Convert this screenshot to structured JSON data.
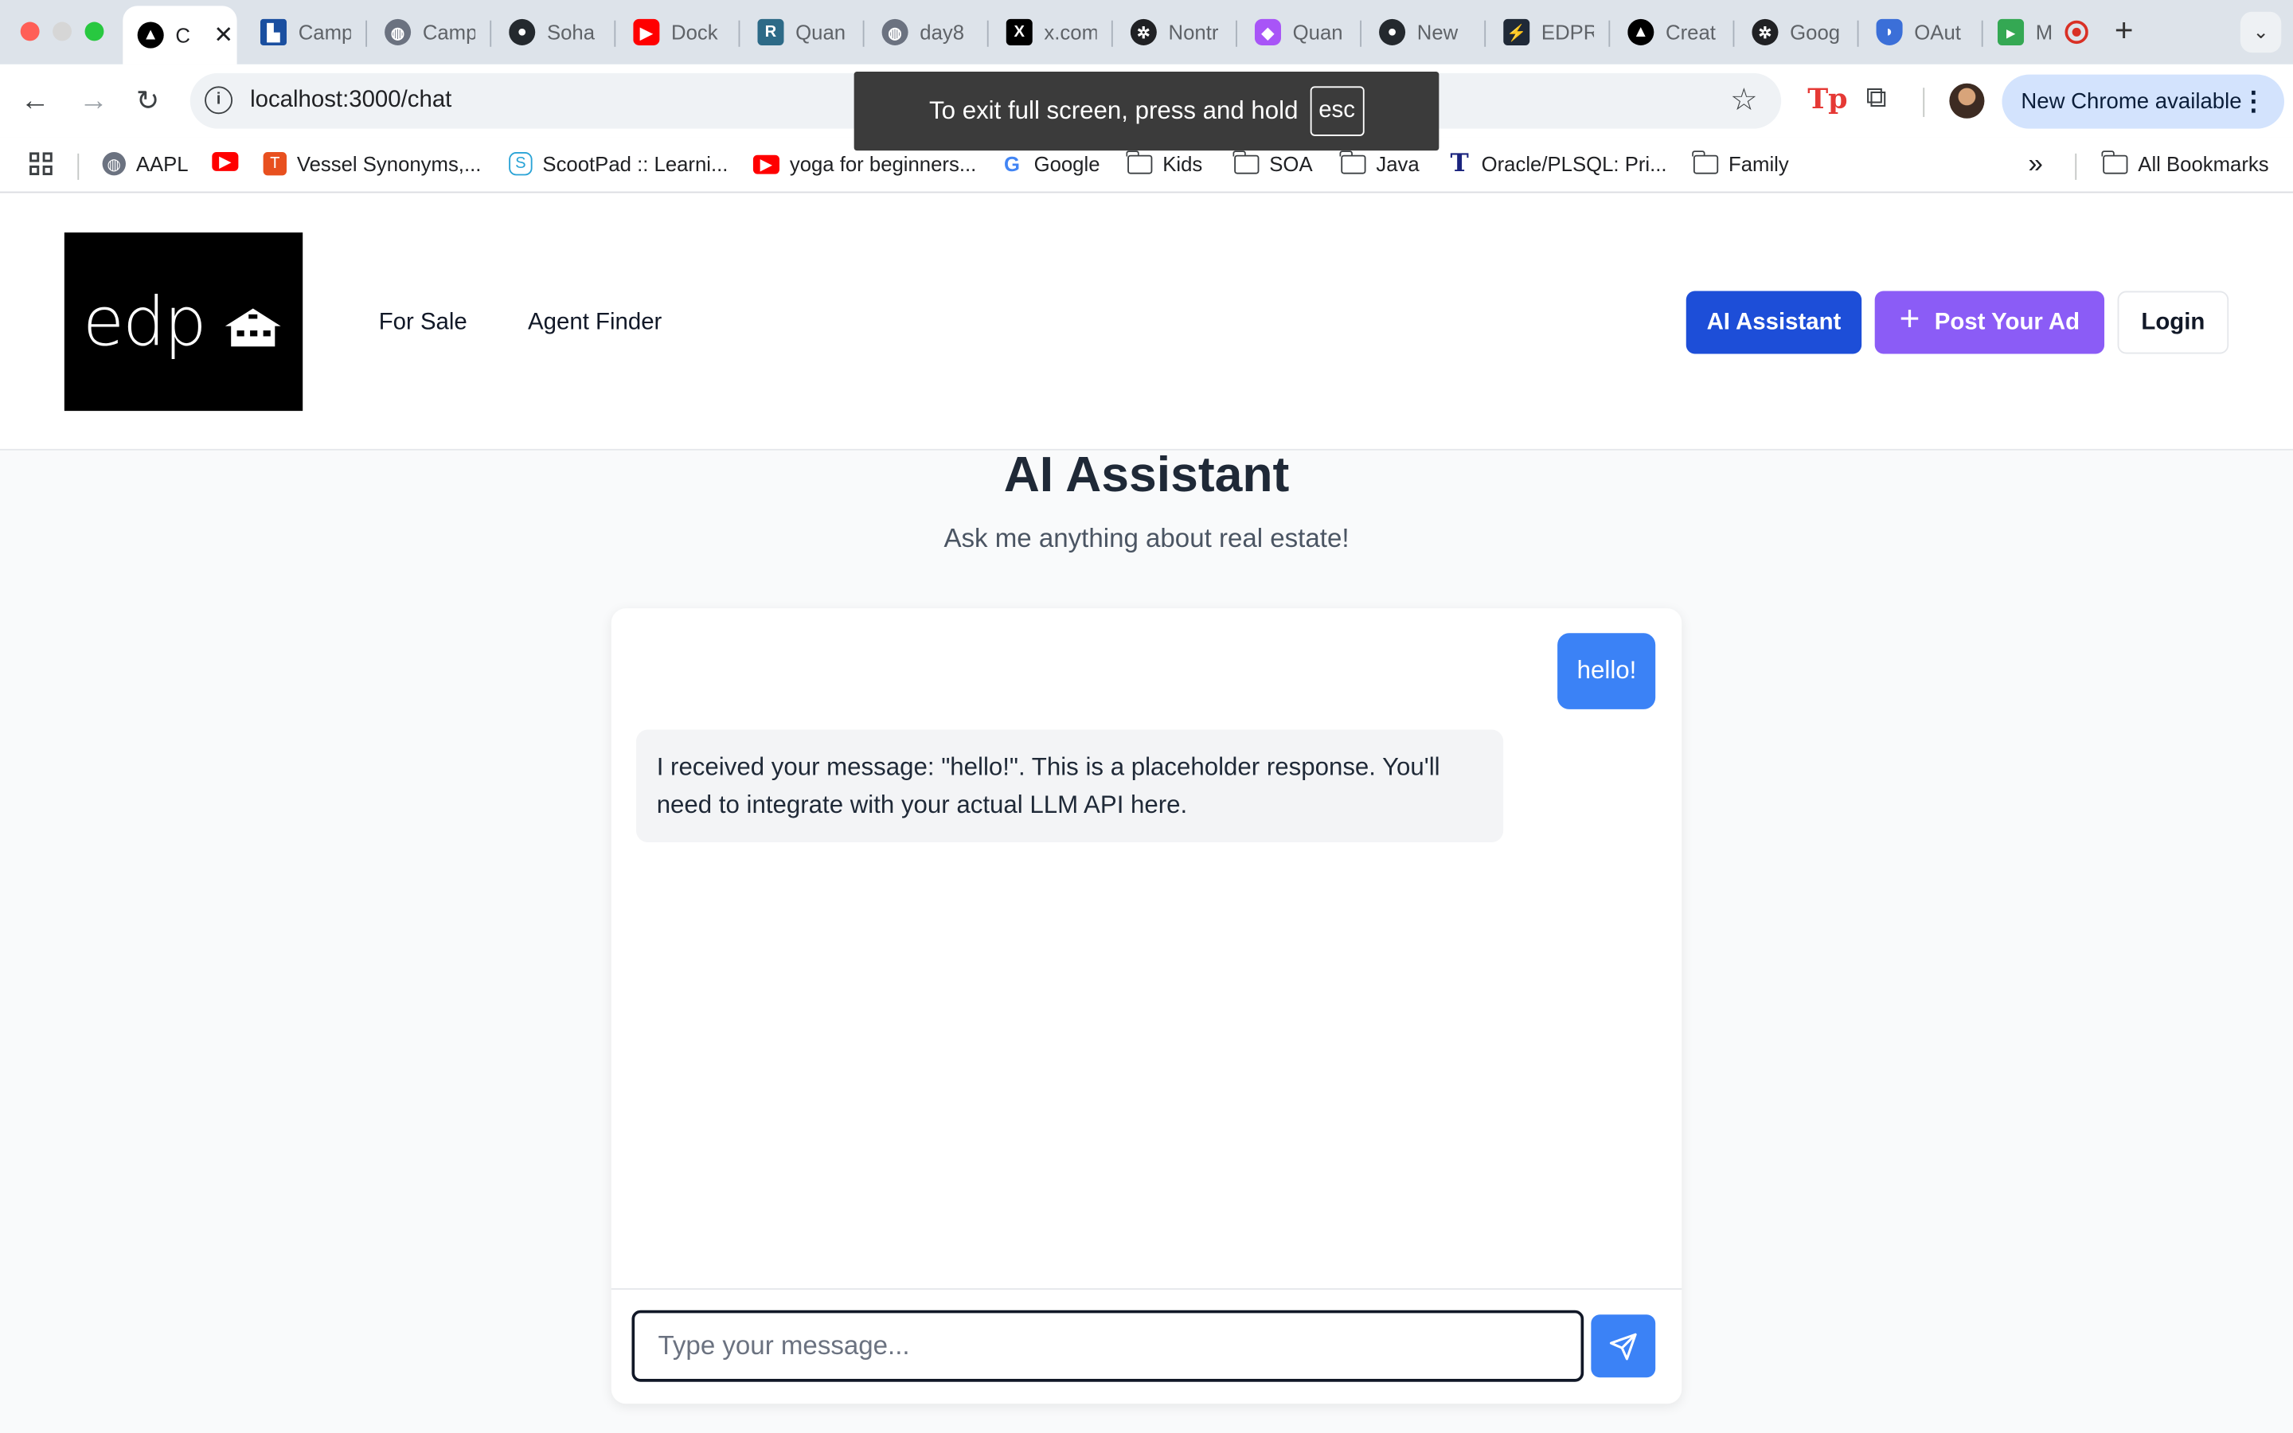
{
  "browser": {
    "tabs": [
      {
        "label": "C",
        "icon": "triangle-logo-icon"
      },
      {
        "label": "Camp",
        "icon": "castle-icon"
      },
      {
        "label": "Camp",
        "icon": "globe-icon"
      },
      {
        "label": "Soha",
        "icon": "github-icon"
      },
      {
        "label": "Dock",
        "icon": "youtube-icon"
      },
      {
        "label": "Quan",
        "icon": "r-logo-icon"
      },
      {
        "label": "day8",
        "icon": "globe-icon"
      },
      {
        "label": "x.com",
        "icon": "x-logo-icon"
      },
      {
        "label": "Nontr",
        "icon": "openai-icon"
      },
      {
        "label": "Quan",
        "icon": "chat-logo-icon"
      },
      {
        "label": "New",
        "icon": "github-icon"
      },
      {
        "label": "EDPR",
        "icon": "bolt-icon"
      },
      {
        "label": "Creat",
        "icon": "triangle-logo-icon"
      },
      {
        "label": "Goog",
        "icon": "openai-icon"
      },
      {
        "label": "OAut",
        "icon": "shield-icon"
      },
      {
        "label": "M",
        "icon": "meet-icon"
      }
    ],
    "new_tab_glyph": "+",
    "url": "localhost:3000/chat",
    "fullscreen_notice": "To exit full screen, press and hold",
    "fullscreen_key": "esc",
    "update_label": "New Chrome available",
    "extension_label": "Tp",
    "bookmarks": [
      {
        "label": "AAPL",
        "icon": "globe-icon"
      },
      {
        "label": "",
        "icon": "youtube-icon"
      },
      {
        "label": "Vessel Synonyms,...",
        "icon": "t-logo-icon"
      },
      {
        "label": "ScootPad :: Learni...",
        "icon": "s-logo-icon"
      },
      {
        "label": "yoga for beginners...",
        "icon": "youtube-icon"
      },
      {
        "label": "Google",
        "icon": "google-icon"
      },
      {
        "label": "Kids",
        "icon": "folder-icon"
      },
      {
        "label": "SOA",
        "icon": "folder-icon"
      },
      {
        "label": "Java",
        "icon": "folder-icon"
      },
      {
        "label": "Oracle/PLSQL: Pri...",
        "icon": "t-serif-icon"
      },
      {
        "label": "Family",
        "icon": "folder-icon"
      }
    ],
    "bookmarks_overflow": "»",
    "all_bookmarks": "All Bookmarks"
  },
  "site": {
    "logo_text": "edp",
    "nav": [
      "For Sale",
      "Agent Finder"
    ],
    "ai_button": "AI Assistant",
    "post_button": "Post Your Ad",
    "login_button": "Login",
    "colors": {
      "ai_button": "#1d4ed8",
      "post_button": "#8b5cf6",
      "user_bubble": "#3b82f6"
    }
  },
  "chat": {
    "title": "AI Assistant",
    "subtitle": "Ask me anything about real estate!",
    "messages": [
      {
        "role": "user",
        "text": "hello!"
      },
      {
        "role": "assistant",
        "text": "I received your message: \"hello!\". This is a placeholder response. You'll need to integrate with your actual LLM API here."
      }
    ],
    "input_placeholder": "Type your message..."
  }
}
